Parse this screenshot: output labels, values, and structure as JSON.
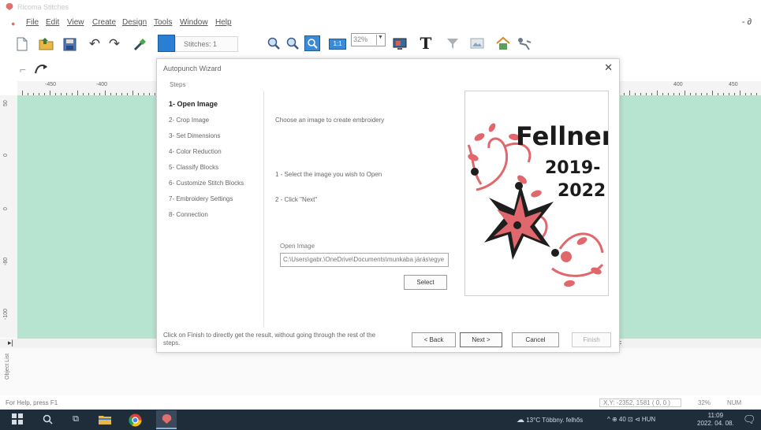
{
  "titlebar": {
    "title": "Ricoma Stitches"
  },
  "menubar": {
    "items": [
      "File",
      "Edit",
      "View",
      "Create",
      "Design",
      "Tools",
      "Window",
      "Help"
    ],
    "restore_glyph": "- ∂"
  },
  "toolbar": {
    "stitches_label": "Stitches: 1",
    "zoom_value": "32%",
    "icons": [
      "new-file-icon",
      "open-folder-icon",
      "save-icon",
      "undo-icon",
      "redo-icon",
      "wand-icon",
      "color-swatch-icon",
      "zoom-in-icon",
      "zoom-out-icon",
      "zoom-fit-icon",
      "zoom-box-icon",
      "display-icon",
      "text-icon",
      "funnel-icon",
      "picture-icon",
      "house-icon",
      "run-icon"
    ]
  },
  "toolbar2": {
    "icons": [
      "select-tool-icon",
      "node-tool-icon"
    ]
  },
  "rulers": {
    "top_labels": [
      "-450",
      "-400",
      "400",
      "450"
    ],
    "left_labels": [
      "50",
      "0",
      "0",
      "-80",
      "-100"
    ]
  },
  "canvas": {
    "color": "#b7e4d0"
  },
  "side_panel": {
    "label": "Object List"
  },
  "wizard": {
    "title": "Autopunch Wizard",
    "close_glyph": "✕",
    "steps_header": "Steps",
    "steps": [
      "1- Open Image",
      "2- Crop Image",
      "3- Set Dimensions",
      "4- Color Reduction",
      "5- Classify Blocks",
      "6- Customize Stitch Blocks",
      "7- Embroidery Settings",
      "8- Connection"
    ],
    "active_step": 0,
    "intro_text": "Choose an image to create embroidery",
    "instructions": [
      "1 - Select the image you wish to Open",
      "2 - Click \"Next\""
    ],
    "open_image_label": "Open Image",
    "open_image_path": "C:\\Users\\gabr.\\OneDrive\\Documents\\munkaba járás\\egye",
    "select_button": "Select",
    "finish_note": "Click on Finish to directly get the result, without going through the rest of the steps.",
    "buttons": {
      "back": "< Back",
      "next": "Next >",
      "cancel": "Cancel",
      "finish": "Finish"
    },
    "preview": {
      "line1": "Fellner",
      "line2": "2019-",
      "line3": "2022",
      "flower_color": "#e0686c",
      "dark_color": "#1e1e1e"
    }
  },
  "statusbar": {
    "help_text": "For Help, press F1",
    "position": "X,Y: -2352, 1581 ( 0, 0 )",
    "zoom": "32%",
    "num": "NUM"
  },
  "taskbar": {
    "icons": [
      "windows-start-icon",
      "search-icon",
      "task-view-icon",
      "file-explorer-icon",
      "chrome-icon",
      "stitches-app-icon"
    ],
    "weather": "13°C Többny. felhős",
    "tray_text": "^ ⊕ 40 ⊡ ⊲ HUN",
    "time": "11:09",
    "date": "2022. 04. 08."
  }
}
